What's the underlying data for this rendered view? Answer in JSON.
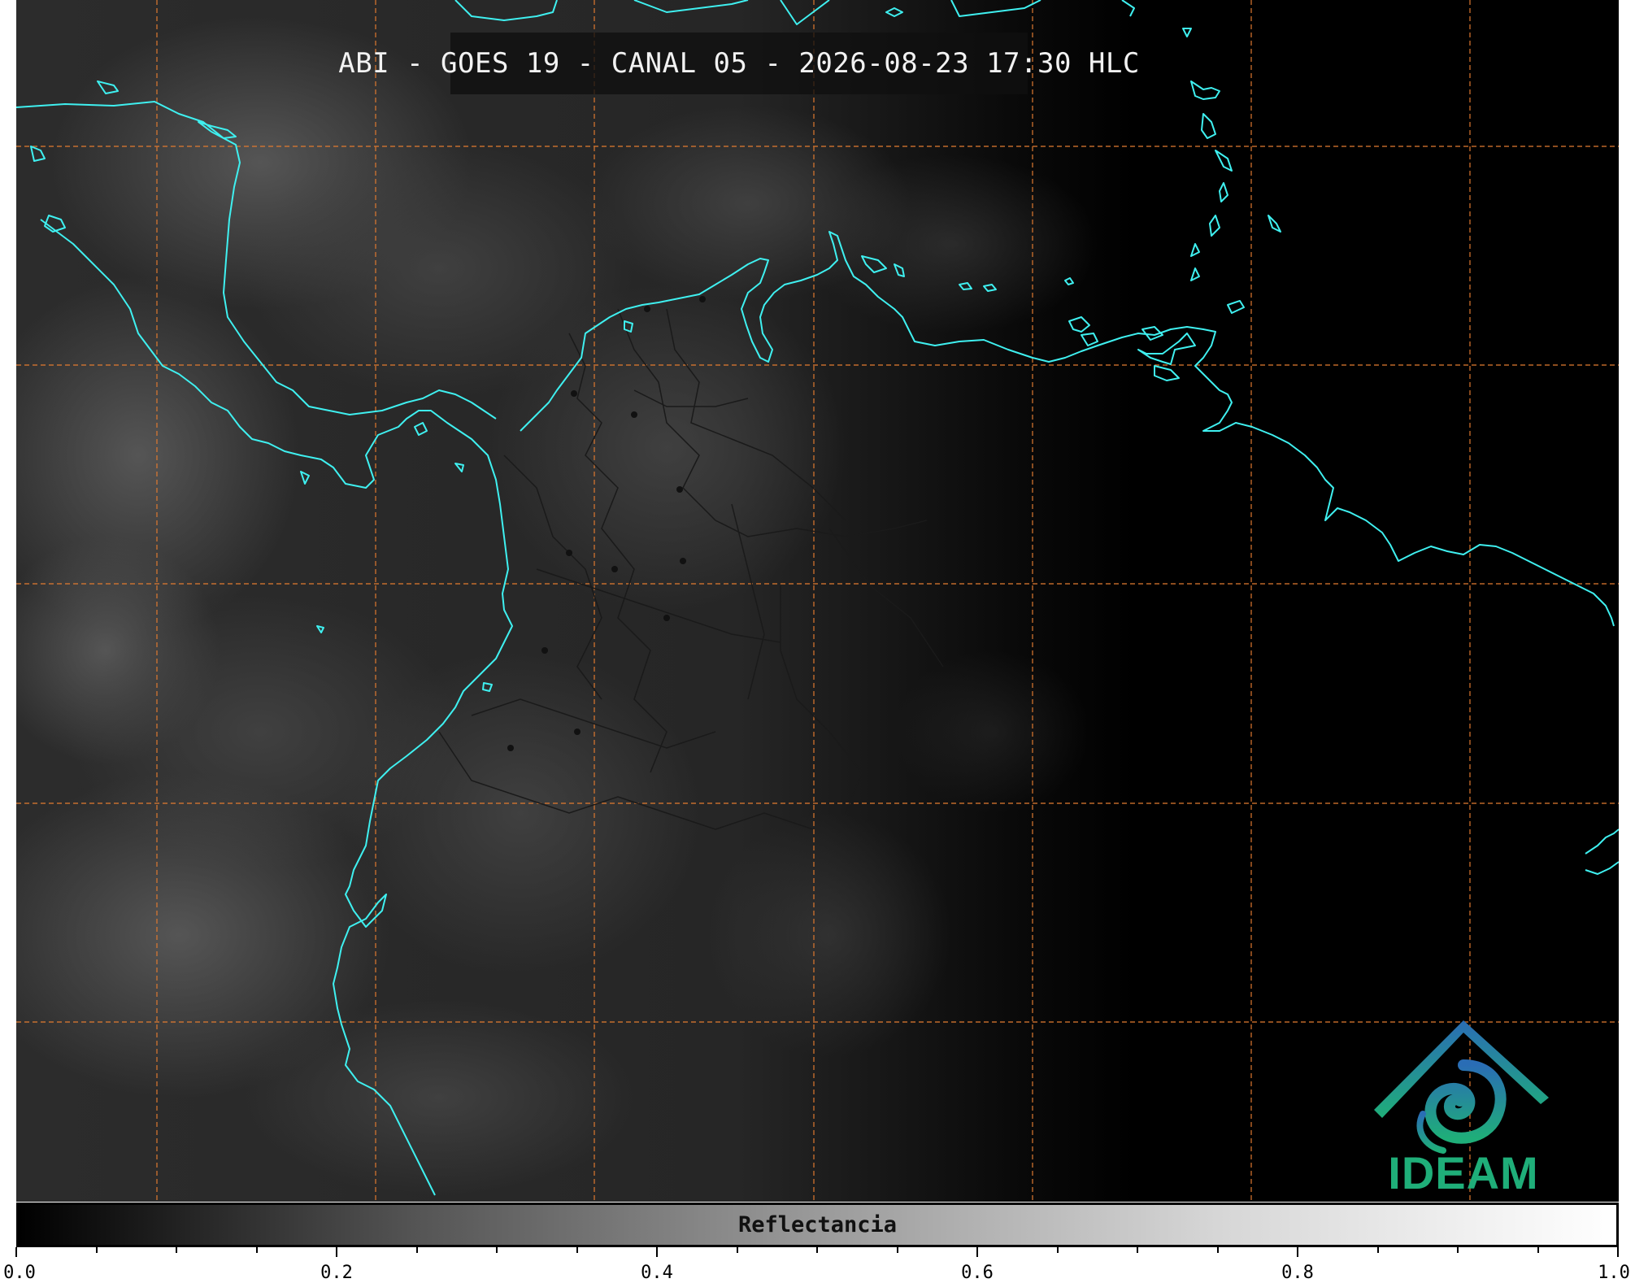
{
  "map": {
    "title": "ABI - GOES 19 - CANAL 05 - 2026-08-23 17:30 HLC",
    "coastline_color": "#3ff0f0",
    "graticule_color": "#e07a30",
    "border_color": "#1a1a1a"
  },
  "logo": {
    "text": "IDEAM",
    "icon": "ideam-logo-icon",
    "colors": [
      "#2a6db5",
      "#1fae79"
    ]
  },
  "colorbar": {
    "label": "Reflectancia",
    "range": [
      0.0,
      1.0
    ],
    "tick_labels": [
      "0.0",
      "0.2",
      "0.4",
      "0.6",
      "0.8",
      "1.0"
    ]
  }
}
